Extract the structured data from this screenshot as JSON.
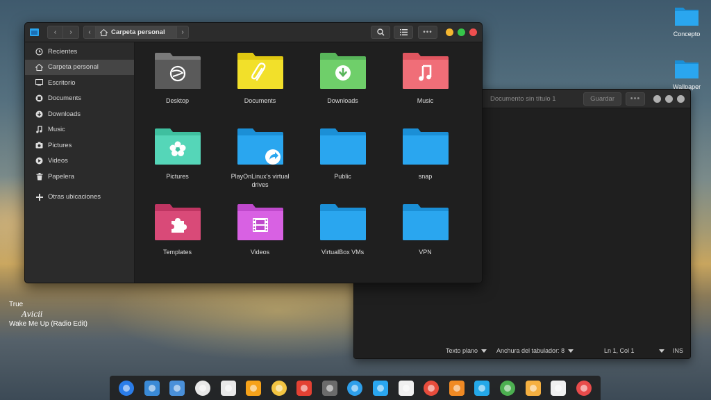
{
  "desktop": {
    "icons": [
      {
        "label": "Concepto",
        "icon": "folder-icon"
      },
      {
        "label": "Wallpaper",
        "icon": "folder-icon"
      }
    ],
    "music_widget": {
      "line1": "True",
      "line2": "Avicii",
      "line3": "Wake Me Up (Radio Edit)"
    }
  },
  "file_manager": {
    "path_label": "Carpeta personal",
    "sidebar": {
      "items": [
        {
          "label": "Recientes",
          "icon": "clock-icon"
        },
        {
          "label": "Carpeta personal",
          "icon": "home-icon",
          "active": true
        },
        {
          "label": "Escritorio",
          "icon": "desktop-icon"
        },
        {
          "label": "Documents",
          "icon": "document-icon"
        },
        {
          "label": "Downloads",
          "icon": "download-icon"
        },
        {
          "label": "Music",
          "icon": "music-icon"
        },
        {
          "label": "Pictures",
          "icon": "camera-icon"
        },
        {
          "label": "Videos",
          "icon": "video-icon"
        },
        {
          "label": "Papelera",
          "icon": "trash-icon"
        }
      ],
      "other_locations": "Otras ubicaciones"
    },
    "folders": [
      {
        "label": "Desktop",
        "color": "#5a5a5a",
        "tab": "#7a7a7a",
        "emblem": "deepin-logo-icon"
      },
      {
        "label": "Documents",
        "color": "#f2e02a",
        "tab": "#e0c811",
        "emblem": "paperclip-icon"
      },
      {
        "label": "Downloads",
        "color": "#6fcf6a",
        "tab": "#58b55a",
        "emblem": "download-icon"
      },
      {
        "label": "Music",
        "color": "#f06e78",
        "tab": "#e05660",
        "emblem": "music-note-icon"
      },
      {
        "label": "Pictures",
        "color": "#55d6b8",
        "tab": "#3fbf9f",
        "emblem": "flower-icon"
      },
      {
        "label": "PlayOnLinux's virtual drives",
        "color": "#2aa6ef",
        "tab": "#1b8fd6",
        "emblem": "share-arrow-icon"
      },
      {
        "label": "Public",
        "color": "#2aa6ef",
        "tab": "#1b8fd6",
        "emblem": ""
      },
      {
        "label": "snap",
        "color": "#2aa6ef",
        "tab": "#1b8fd6",
        "emblem": ""
      },
      {
        "label": "Templates",
        "color": "#d94a78",
        "tab": "#bf3562",
        "emblem": "puzzle-icon"
      },
      {
        "label": "Videos",
        "color": "#d861e3",
        "tab": "#bf49cc",
        "emblem": "film-icon"
      },
      {
        "label": "VirtualBox VMs",
        "color": "#2aa6ef",
        "tab": "#1b8fd6",
        "emblem": ""
      },
      {
        "label": "VPN",
        "color": "#2aa6ef",
        "tab": "#1b8fd6",
        "emblem": ""
      }
    ]
  },
  "editor": {
    "title": "Documento sin título 1",
    "save_label": "Guardar",
    "status": {
      "language": "Texto plano",
      "tab_width": "Anchura del tabulador: 8",
      "position": "Ln 1, Col 1",
      "mode": "INS"
    }
  },
  "dock": {
    "items": [
      "launcher-icon",
      "image-viewer-icon",
      "workspace-icon",
      "files-icon",
      "screenshot-icon",
      "orange-icon",
      "media-player-icon",
      "chrome-icon",
      "settings-icon",
      "send-icon",
      "finder-icon",
      "text-editor-icon",
      "disk-icon",
      "eject-icon",
      "wifi-icon",
      "power-icon",
      "cat-icon",
      "calendar-icon",
      "trash-icon"
    ]
  },
  "colors": {
    "accent_red": "#ee4f4f",
    "accent_yellow": "#f5b731",
    "accent_green": "#36c54a",
    "folder_blue": "#2aa6ef"
  }
}
